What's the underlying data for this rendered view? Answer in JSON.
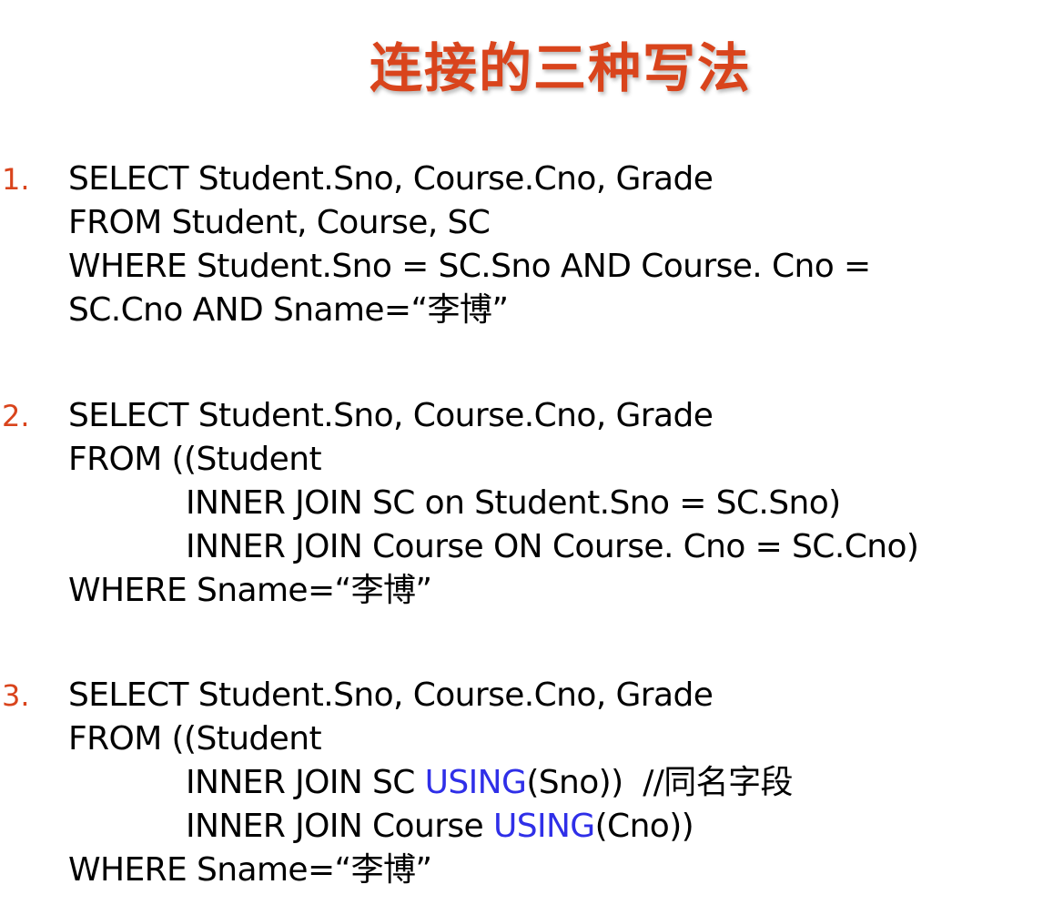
{
  "title": "连接的三种写法",
  "accent_color": "#d9441c",
  "keyword_color": "#2f2fe8",
  "examples": [
    {
      "number": "1.",
      "lines": [
        "SELECT Student.Sno, Course.Cno, Grade",
        "FROM Student, Course, SC",
        "WHERE Student.Sno = SC.Sno AND Course. Cno =",
        "SC.Cno AND Sname=“李博”"
      ]
    },
    {
      "number": "2.",
      "lines": [
        "SELECT Student.Sno, Course.Cno, Grade",
        "FROM ((Student",
        "INNER JOIN SC on Student.Sno = SC.Sno)",
        "INNER JOIN Course ON Course. Cno = SC.Cno)",
        "WHERE Sname=“李博”"
      ]
    },
    {
      "number": "3.",
      "lines": [
        "SELECT Student.Sno, Course.Cno, Grade",
        "FROM ((Student",
        {
          "pre": "INNER JOIN SC ",
          "kw": "USING",
          "post": "(Sno))  //同名字段"
        },
        {
          "pre": "INNER JOIN Course ",
          "kw": "USING",
          "post": "(Cno))"
        },
        "WHERE Sname=“李博”"
      ]
    }
  ]
}
